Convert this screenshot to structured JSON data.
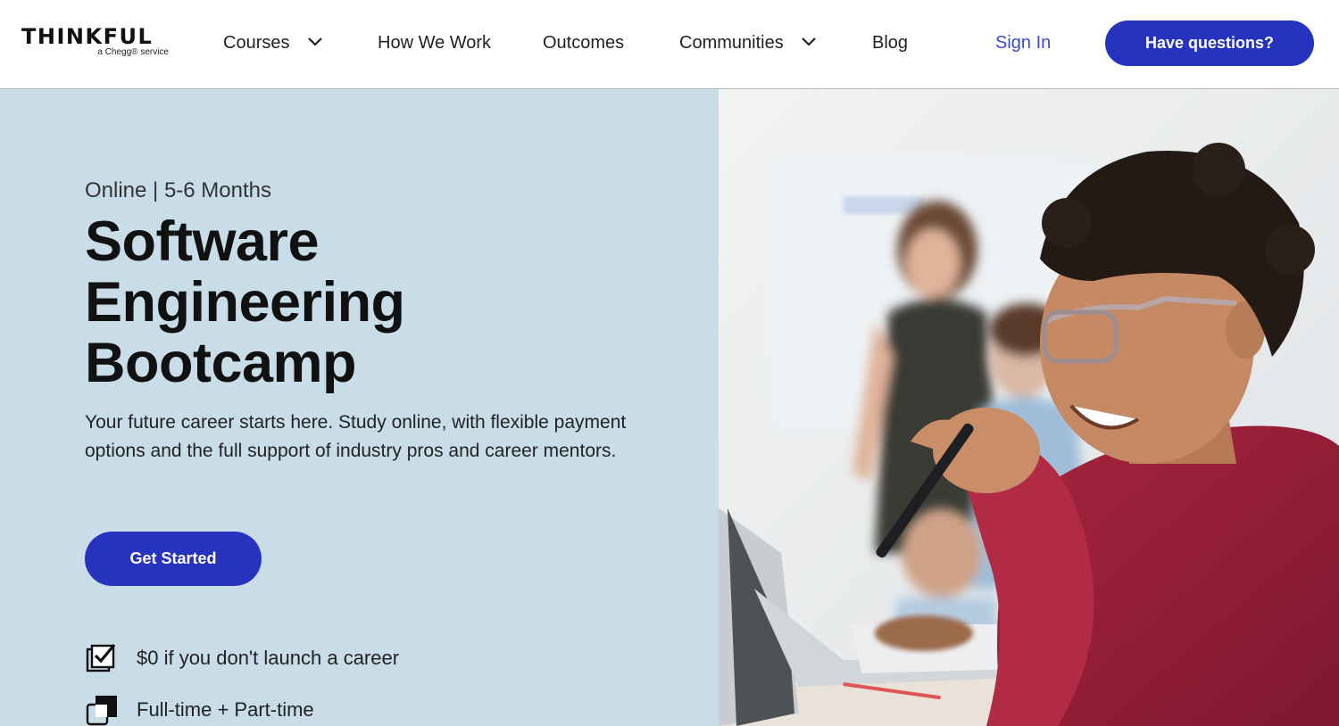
{
  "brand": {
    "name": "THINKFUL",
    "tagline": "a Chegg® service"
  },
  "nav": {
    "items": [
      {
        "label": "Courses",
        "has_dropdown": true
      },
      {
        "label": "How We Work",
        "has_dropdown": false
      },
      {
        "label": "Outcomes",
        "has_dropdown": false
      },
      {
        "label": "Communities",
        "has_dropdown": true
      },
      {
        "label": "Blog",
        "has_dropdown": false
      }
    ],
    "sign_in": "Sign In",
    "cta": "Have questions?"
  },
  "hero": {
    "eyebrow": "Online | 5-6 Months",
    "title_lines": [
      "Software",
      "Engineering",
      "Bootcamp"
    ],
    "description": "Your future career starts here. Study online, with flexible payment options and the full support of industry pros and career mentors.",
    "cta": "Get Started",
    "features": [
      {
        "icon": "checkbox-check-icon",
        "text": "$0 if you don't launch a career"
      },
      {
        "icon": "overlapping-squares-icon",
        "text": "Full-time + Part-time"
      }
    ]
  },
  "colors": {
    "brand_blue": "#2533bf",
    "link_blue": "#3d4dbf",
    "hero_bg": "#c9dde9",
    "text_dark": "#111111"
  }
}
